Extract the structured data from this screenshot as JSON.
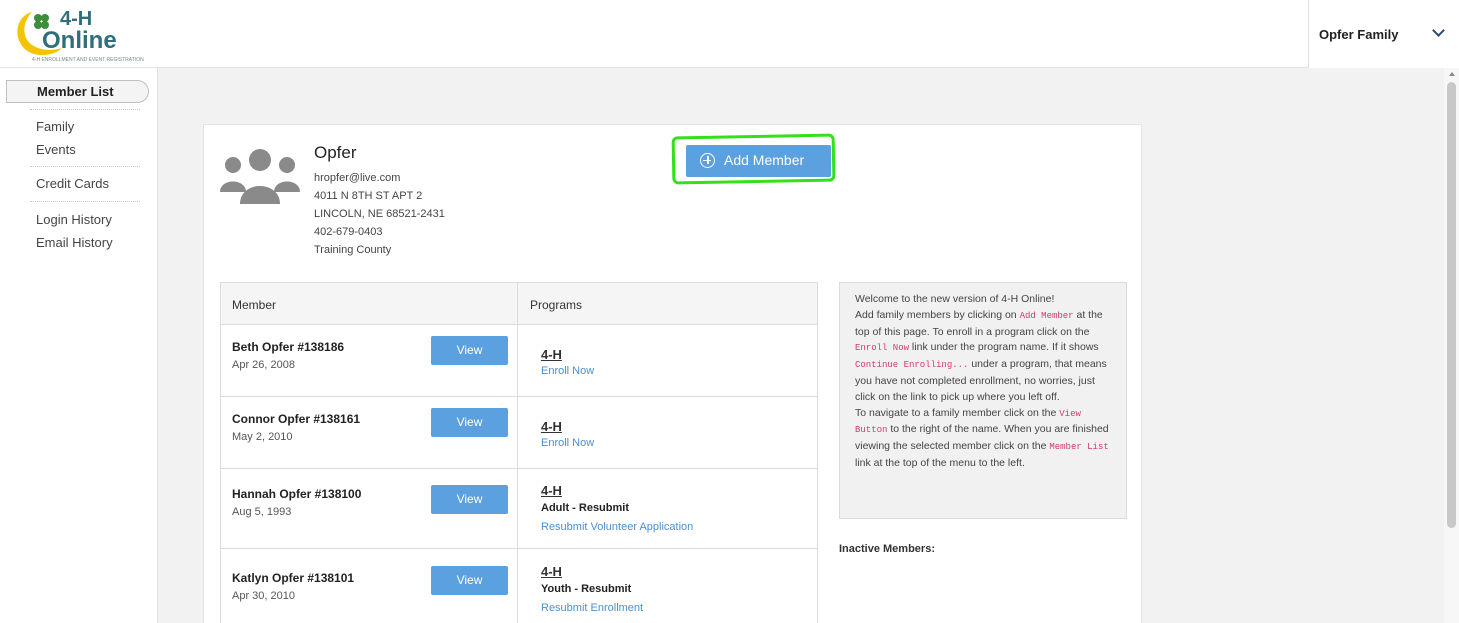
{
  "header": {
    "logo_line1": "4-H",
    "logo_line2": "Online",
    "logo_tagline": "4-H ENROLLMENT AND EVENT REGISTRATION",
    "family_switcher_label": "Opfer Family"
  },
  "sidebar": {
    "active_item": "Member List",
    "items": [
      "Family",
      "Events",
      "Credit Cards",
      "Login History",
      "Email History"
    ]
  },
  "family": {
    "name": "Opfer",
    "email": "hropfer@live.com",
    "address1": "4011 N 8TH ST APT 2",
    "address2": "LINCOLN, NE 68521-2431",
    "phone": "402-679-0403",
    "county": "Training County"
  },
  "add_member_label": "Add Member",
  "table": {
    "col_member": "Member",
    "col_programs": "Programs",
    "rows": [
      {
        "name": "Beth Opfer #138186",
        "dob": "Apr 26, 2008",
        "view": "View",
        "program": "4-H",
        "status": "",
        "link": "Enroll Now"
      },
      {
        "name": "Connor Opfer #138161",
        "dob": "May 2, 2010",
        "view": "View",
        "program": "4-H",
        "status": "",
        "link": "Enroll Now"
      },
      {
        "name": "Hannah Opfer #138100",
        "dob": "Aug 5, 1993",
        "view": "View",
        "program": "4-H",
        "status": "Adult - Resubmit",
        "link": "Resubmit Volunteer Application"
      },
      {
        "name": "Katlyn Opfer #138101",
        "dob": "Apr 30, 2010",
        "view": "View",
        "program": "4-H",
        "status": "Youth - Resubmit",
        "link": "Resubmit Enrollment"
      }
    ]
  },
  "info": {
    "t1": "Welcome to the new version of 4-H Online!",
    "t2": "Add family members by clicking on ",
    "c1": "Add Member",
    "t3": " at the top of this page. To enroll in a program click on the ",
    "c2": "Enroll Now",
    "t4": " link under the program name. If it shows ",
    "c3": "Continue Enrolling...",
    "t5": " under a program, that means you have not completed enrollment, no worries, just click on the link to pick up where you left off.",
    "t6": "To navigate to a family member click on the ",
    "c4": "View Button",
    "t7": " to the right of the name. When you are finished viewing the selected member click on the ",
    "c5": "Member List",
    "t8": " link at the top of the menu to the left."
  },
  "inactive_label": "Inactive Members:",
  "colors": {
    "primary_button": "#5ba0df",
    "link": "#4a8fd0",
    "code": "#d63a6a",
    "highlight": "#33e01a"
  }
}
